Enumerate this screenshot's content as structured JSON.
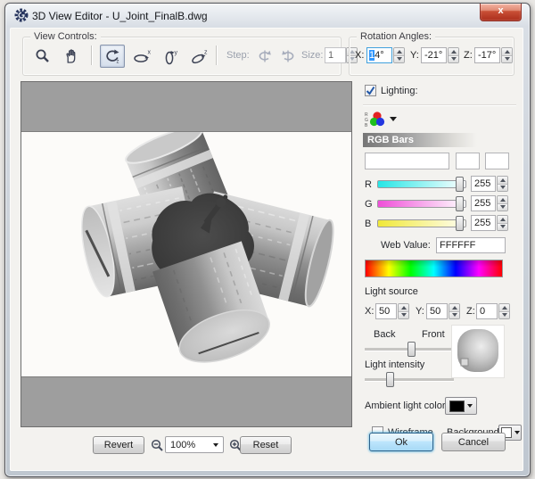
{
  "window": {
    "title": "3D View Editor - U_Joint_FinalB.dwg",
    "close": "x"
  },
  "view_controls": {
    "title": "View Controls:",
    "step_label": "Step:",
    "size_label": "Size:",
    "size_value": "1"
  },
  "rotation": {
    "title": "Rotation Angles:",
    "x_label": "X:",
    "x_value_selected": "1",
    "x_value_rest": "4°",
    "y_label": "Y:",
    "y_value": "-21°",
    "z_label": "Z:",
    "z_value": "-17°"
  },
  "lighting": {
    "label": "Lighting:",
    "rgb_bars_title": "RGB Bars",
    "channels": [
      {
        "label": "R",
        "value": "255"
      },
      {
        "label": "G",
        "value": "255"
      },
      {
        "label": "B",
        "value": "255"
      }
    ],
    "web_value_label": "Web Value:",
    "web_value": "FFFFFF",
    "light_source_label": "Light source",
    "lsx_label": "X:",
    "lsx_value": "50",
    "lsy_label": "Y:",
    "lsy_value": "50",
    "lsz_label": "Z:",
    "lsz_value": "0",
    "back_label": "Back",
    "front_label": "Front",
    "intensity_label": "Light intensity",
    "ambient_label": "Ambient light color",
    "ambient_color": "#000000"
  },
  "options": {
    "wireframe_label": "Wireframe",
    "background_label": "Background",
    "background_color": "#ffffff"
  },
  "bottom_bar": {
    "revert": "Revert",
    "zoom_value": "100%",
    "reset": "Reset"
  },
  "actions": {
    "ok": "Ok",
    "cancel": "Cancel"
  },
  "colors": {
    "r_track_left": "#26e6e6",
    "g_track_left": "#ef4fd8",
    "b_track_left": "#f0e838",
    "track_right": "#ffffff",
    "viewport_band": "#9e9e9e",
    "ok_button_border": "#2c628b",
    "close_button": "#c94f36",
    "selection_blue": "#3297fd"
  }
}
